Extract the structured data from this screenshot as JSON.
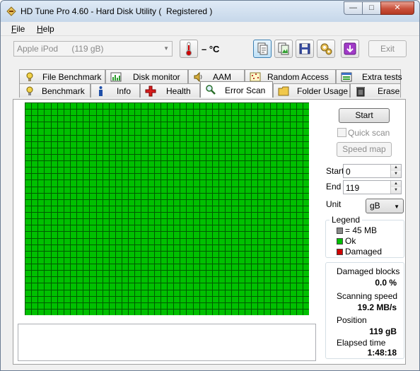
{
  "window": {
    "title": "HD Tune Pro 4.60 - Hard Disk Utility (  Registered )",
    "min_label": "—",
    "max_label": "□",
    "close_label": "✕"
  },
  "menu": {
    "file_acc": "F",
    "file_rest": "ile",
    "help_acc": "H",
    "help_rest": "elp"
  },
  "toolbar": {
    "drive_name": "Apple   iPod",
    "drive_size": "(119 gB)",
    "temperature": "– °C",
    "exit_label": "Exit",
    "icons": [
      "thermometer-icon",
      "copy-text-icon",
      "copy-screenshot-icon",
      "save-icon",
      "options-icon",
      "download-icon"
    ]
  },
  "tabs": {
    "back_row": [
      "File Benchmark",
      "Disk monitor",
      "AAM",
      "Random Access",
      "Extra tests"
    ],
    "front_row": [
      "Benchmark",
      "Info",
      "Health",
      "Error Scan",
      "Folder Usage",
      "Erase"
    ],
    "selected": "Error Scan"
  },
  "scan_map": {
    "columns": 44,
    "rows": 33,
    "block_color": "#00c000",
    "grid_color": "#005a00"
  },
  "controls": {
    "start_button": "Start",
    "quick_scan_label": "Quick scan",
    "speed_map_button": "Speed map",
    "start_label": "Start",
    "start_value": "0",
    "end_label": "End",
    "end_value": "119",
    "unit_label": "Unit",
    "unit_value": "gB"
  },
  "legend": {
    "title": "Legend",
    "items": [
      {
        "label": "= 45 MB",
        "color": "#8a8a8a"
      },
      {
        "label": "Ok",
        "color": "#00c000"
      },
      {
        "label": "Damaged",
        "color": "#d00000"
      }
    ]
  },
  "stats": {
    "damaged_blocks_label": "Damaged blocks",
    "damaged_blocks_value": "0.0 %",
    "scanning_speed_label": "Scanning speed",
    "scanning_speed_value": "19.2 MB/s",
    "position_label": "Position",
    "position_value": "119 gB",
    "elapsed_label": "Elapsed time",
    "elapsed_value": "1:48:18"
  }
}
